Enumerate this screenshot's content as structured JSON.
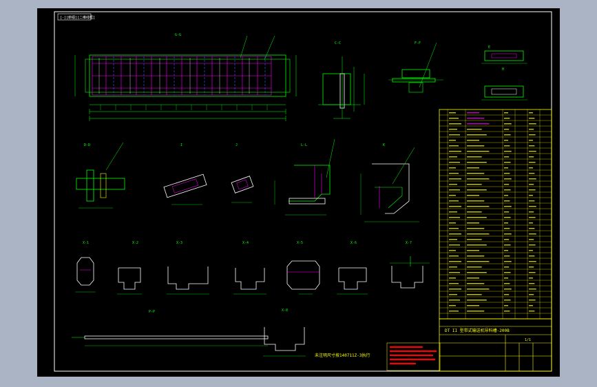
{
  "viewport_label": "[-][俯视][二维线框]",
  "colors": {
    "background": "#000000",
    "frame": "#ffffff",
    "primary": "#00ff00",
    "dimension": "#00e0e0",
    "secondary": "#ffff00",
    "leader": "#00ff00",
    "highlight": "#ff00ff",
    "hidden": "#4060ff",
    "red": "#ff0000"
  },
  "views": {
    "top_plan": "G-G",
    "c_c": "C-C",
    "f_f": "F-F",
    "e": "E",
    "h": "H",
    "d_d": "D-D",
    "i": "I",
    "j": "J",
    "l_l": "L-L",
    "k": "K",
    "x1": "X-1",
    "x2": "X-2",
    "x3": "X-3",
    "x4": "X-4",
    "x5": "X-5",
    "x6": "X-6",
    "x7": "X-7",
    "x8": "X-8",
    "p_p": "P-P"
  },
  "note_text": "未注明尺寸按140711Z-3执行",
  "title_block": {
    "title": "DT II 型带式输送机导料槽-200B",
    "sheet": "1/1"
  }
}
